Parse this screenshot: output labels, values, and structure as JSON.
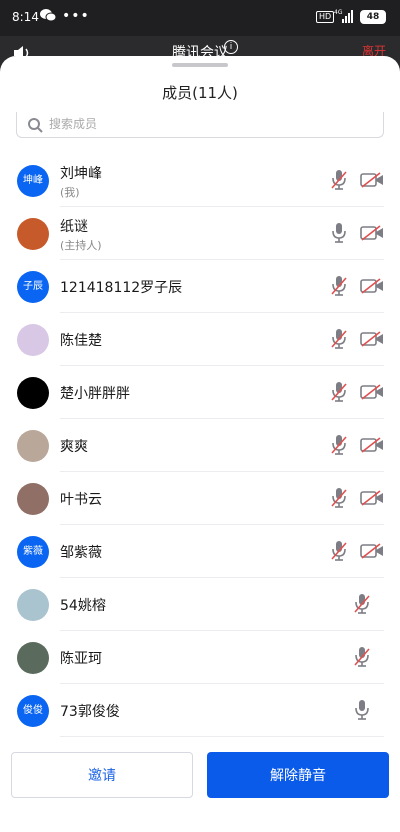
{
  "status_bar": {
    "time": "8:14",
    "dots": "•••",
    "hd": "HD",
    "signal": "4G",
    "battery": "48"
  },
  "header": {
    "title": "腾讯会议",
    "info": "i",
    "right": "离开"
  },
  "panel": {
    "title": "成员(11人)",
    "search_placeholder": "搜索成员"
  },
  "members": [
    {
      "name": "刘坤峰",
      "role": "(我)",
      "avatar_text": "坤峰",
      "avatar_color": "#0a66f2",
      "mic_off": true,
      "cam_off": true,
      "has_cam": true
    },
    {
      "name": "纸谜",
      "role": "(主持人)",
      "avatar_text": "",
      "avatar_color": "#c75a2a",
      "mic_off": false,
      "cam_off": true,
      "has_cam": true
    },
    {
      "name": "121418112罗子辰",
      "role": "",
      "avatar_text": "子辰",
      "avatar_color": "#0a66f2",
      "mic_off": true,
      "cam_off": true,
      "has_cam": true
    },
    {
      "name": "陈佳楚",
      "role": "",
      "avatar_text": "",
      "avatar_color": "#d9c7e6",
      "mic_off": true,
      "cam_off": true,
      "has_cam": true
    },
    {
      "name": "楚小胖胖胖",
      "role": "",
      "avatar_text": "",
      "avatar_color": "#000000",
      "mic_off": true,
      "cam_off": true,
      "has_cam": true
    },
    {
      "name": "爽爽",
      "role": "",
      "avatar_text": "",
      "avatar_color": "#b9a79a",
      "mic_off": true,
      "cam_off": true,
      "has_cam": true
    },
    {
      "name": "叶书云",
      "role": "",
      "avatar_text": "",
      "avatar_color": "#8f6f66",
      "mic_off": true,
      "cam_off": true,
      "has_cam": true
    },
    {
      "name": "邹紫薇",
      "role": "",
      "avatar_text": "紫薇",
      "avatar_color": "#0a66f2",
      "mic_off": true,
      "cam_off": true,
      "has_cam": true
    },
    {
      "name": "54姚榕",
      "role": "",
      "avatar_text": "",
      "avatar_color": "#a9c3cf",
      "mic_off": true,
      "cam_off": false,
      "has_cam": false
    },
    {
      "name": "陈亚珂",
      "role": "",
      "avatar_text": "",
      "avatar_color": "#5a6b5e",
      "mic_off": true,
      "cam_off": false,
      "has_cam": false
    },
    {
      "name": "73郭俊俊",
      "role": "",
      "avatar_text": "俊俊",
      "avatar_color": "#0a66f2",
      "mic_off": false,
      "cam_off": false,
      "has_cam": false
    }
  ],
  "footer": {
    "invite_label": "邀请",
    "unmute_all_label": "解除静音"
  },
  "colors": {
    "accent": "#0a5bea",
    "muted_slash": "#e05050",
    "icon_gray": "#7d7d85"
  }
}
